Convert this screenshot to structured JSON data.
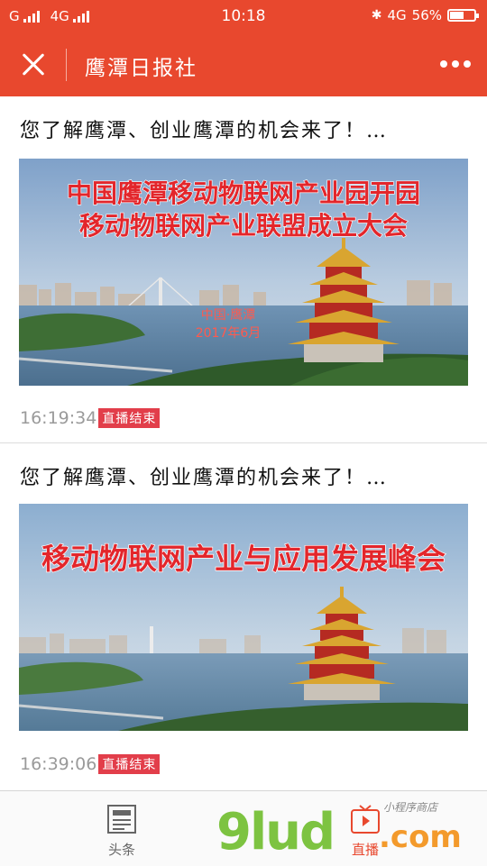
{
  "status_bar": {
    "carrier1": "G",
    "carrier2": "4G",
    "time": "10:18",
    "network": "4G",
    "battery": "56%",
    "battery_level": 0.56
  },
  "header": {
    "title": "鹰潭日报社",
    "close_icon": "close-icon",
    "more_icon": "more-icon"
  },
  "posts": [
    {
      "title": "您了解鹰潭、创业鹰潭的机会来了！…",
      "image": {
        "line1": "中国鹰潭移动物联网产业园开园",
        "line2": "移动物联网产业联盟成立大会",
        "caption1": "中国·鹰潭",
        "caption2": "2017年6月"
      },
      "time": "16:19:34",
      "badge": "直播结束"
    },
    {
      "title": "您了解鹰潭、创业鹰潭的机会来了！…",
      "image": {
        "line1": "移动物联网产业与应用发展峰会"
      },
      "time": "16:39:06",
      "badge": "直播结束"
    }
  ],
  "tabbar": {
    "tabs": [
      {
        "label": "头条",
        "icon": "newspaper-icon"
      },
      {
        "label": "直播",
        "icon": "play-tv-icon"
      }
    ]
  },
  "watermark": {
    "brand": "9lud",
    "domain": ".com",
    "sub": "小程序商店"
  },
  "colors": {
    "accent": "#e8482e",
    "badge": "#e23e4a",
    "meta_text": "#9a9a9a"
  }
}
